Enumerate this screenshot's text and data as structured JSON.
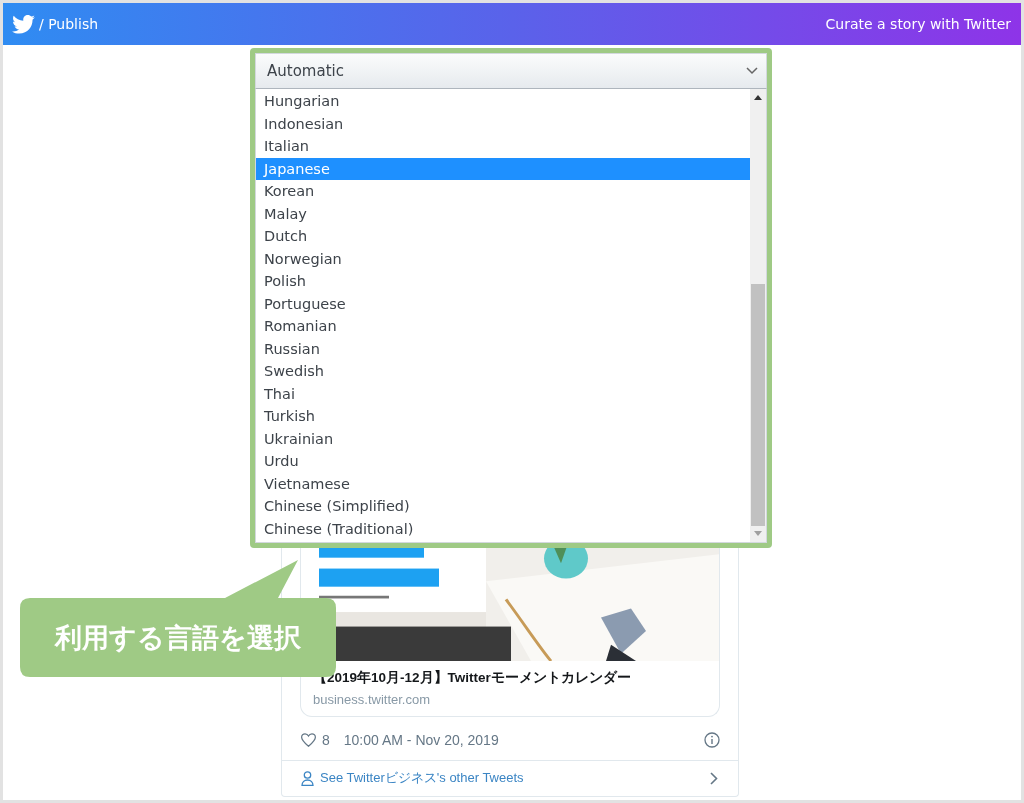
{
  "header": {
    "title": "/ Publish",
    "tagline": "Curate a story with Twitter"
  },
  "language_select": {
    "value": "Automatic",
    "options": [
      {
        "label": "Hungarian",
        "selected": false
      },
      {
        "label": "Indonesian",
        "selected": false
      },
      {
        "label": "Italian",
        "selected": false
      },
      {
        "label": "Japanese",
        "selected": true
      },
      {
        "label": "Korean",
        "selected": false
      },
      {
        "label": "Malay",
        "selected": false
      },
      {
        "label": "Dutch",
        "selected": false
      },
      {
        "label": "Norwegian",
        "selected": false
      },
      {
        "label": "Polish",
        "selected": false
      },
      {
        "label": "Portuguese",
        "selected": false
      },
      {
        "label": "Romanian",
        "selected": false
      },
      {
        "label": "Russian",
        "selected": false
      },
      {
        "label": "Swedish",
        "selected": false
      },
      {
        "label": "Thai",
        "selected": false
      },
      {
        "label": "Turkish",
        "selected": false
      },
      {
        "label": "Ukrainian",
        "selected": false
      },
      {
        "label": "Urdu",
        "selected": false
      },
      {
        "label": "Vietnamese",
        "selected": false
      },
      {
        "label": "Chinese (Simplified)",
        "selected": false
      },
      {
        "label": "Chinese (Traditional)",
        "selected": false
      }
    ]
  },
  "tweet": {
    "link_card": {
      "title": "【2019年10月-12月】Twitterモーメントカレンダー",
      "domain": "business.twitter.com"
    },
    "likes": "8",
    "timestamp": "10:00 AM - Nov 20, 2019",
    "more_link": "See Twitterビジネス's other Tweets"
  },
  "callout": {
    "text": "利用する言語を選択"
  }
}
